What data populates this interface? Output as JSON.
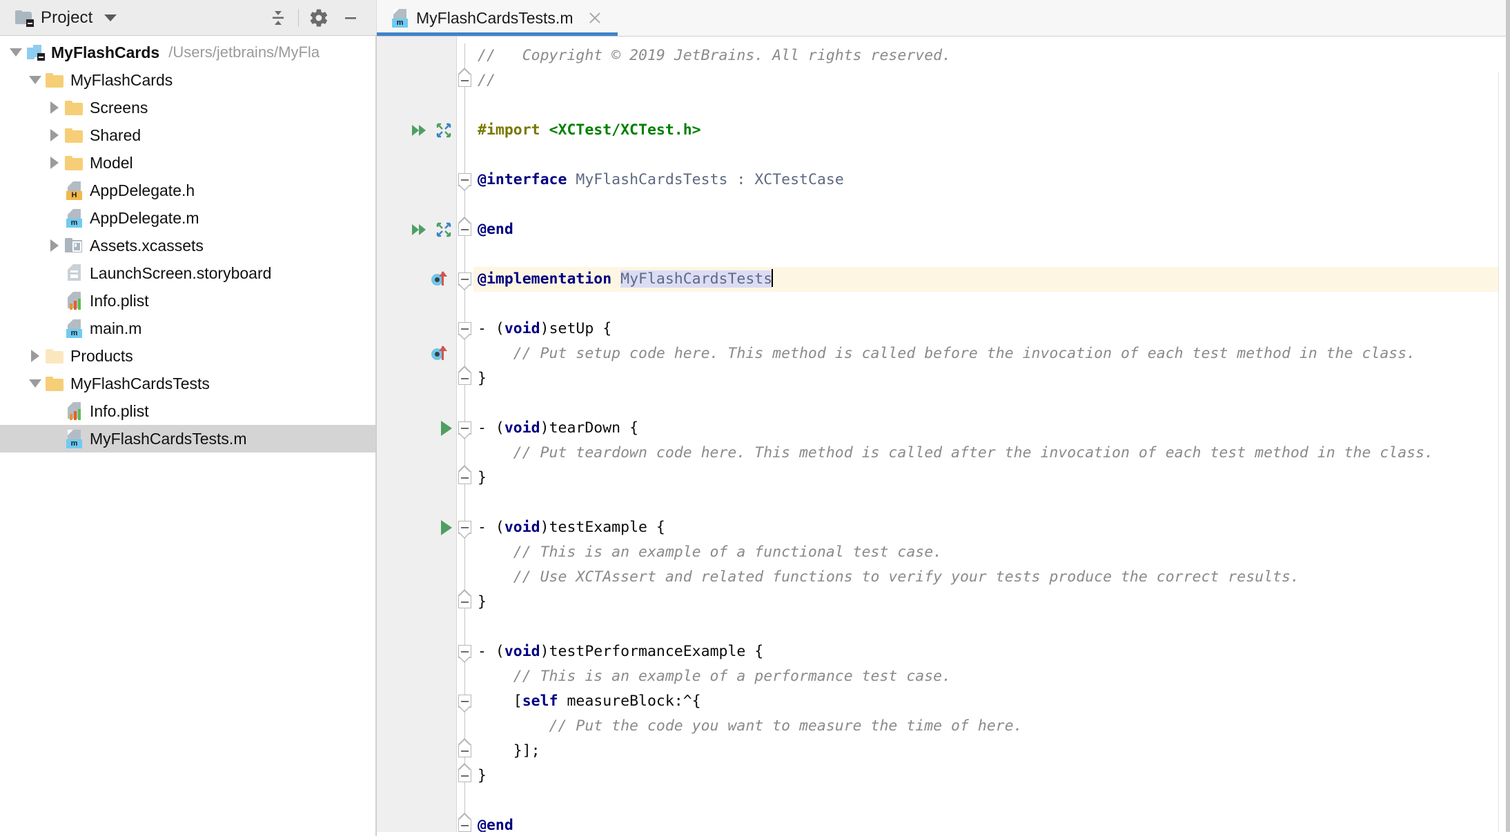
{
  "window": {
    "accent_color": "#4083c9",
    "toolwindow_bg": "#ececec",
    "gutter_bg": "#efefef",
    "selection_bg": "#d4d4d4",
    "caret_row_bg": "#fdf6e3",
    "identifier_highlight_bg": "#dcdcf5"
  },
  "project_toolbar": {
    "title": "Project",
    "title_icon": "project-folder-icon",
    "dropdown_icon": "chevron-down-icon",
    "collapse_all_icon": "collapse-all-icon",
    "settings_icon": "gear-icon",
    "hide_icon": "minimize-icon"
  },
  "tree": {
    "items": [
      {
        "label": "MyFlashCards",
        "path": "/Users/jetbrains/MyFla",
        "icon": "module-icon",
        "indent": 0,
        "twisty": "down",
        "bold": true,
        "selected": false
      },
      {
        "label": "MyFlashCards",
        "path": "",
        "icon": "folder-icon",
        "indent": 1,
        "twisty": "down",
        "bold": false,
        "selected": false
      },
      {
        "label": "Screens",
        "path": "",
        "icon": "folder-icon",
        "indent": 2,
        "twisty": "right",
        "bold": false,
        "selected": false
      },
      {
        "label": "Shared",
        "path": "",
        "icon": "folder-icon",
        "indent": 2,
        "twisty": "right",
        "bold": false,
        "selected": false
      },
      {
        "label": "Model",
        "path": "",
        "icon": "folder-icon",
        "indent": 2,
        "twisty": "right",
        "bold": false,
        "selected": false
      },
      {
        "label": "AppDelegate.h",
        "path": "",
        "icon": "objc-header-file-icon",
        "indent": 2,
        "twisty": "none",
        "bold": false,
        "selected": false
      },
      {
        "label": "AppDelegate.m",
        "path": "",
        "icon": "objc-source-file-icon",
        "indent": 2,
        "twisty": "none",
        "bold": false,
        "selected": false
      },
      {
        "label": "Assets.xcassets",
        "path": "",
        "icon": "xcassets-icon",
        "indent": 2,
        "twisty": "right",
        "bold": false,
        "selected": false
      },
      {
        "label": "LaunchScreen.storyboard",
        "path": "",
        "icon": "storyboard-file-icon",
        "indent": 2,
        "twisty": "none",
        "bold": false,
        "selected": false
      },
      {
        "label": "Info.plist",
        "path": "",
        "icon": "plist-file-icon",
        "indent": 2,
        "twisty": "none",
        "bold": false,
        "selected": false
      },
      {
        "label": "main.m",
        "path": "",
        "icon": "objc-source-file-icon",
        "indent": 2,
        "twisty": "none",
        "bold": false,
        "selected": false
      },
      {
        "label": "Products",
        "path": "",
        "icon": "folder-pale-icon",
        "indent": 1,
        "twisty": "right",
        "bold": false,
        "selected": false
      },
      {
        "label": "MyFlashCardsTests",
        "path": "",
        "icon": "folder-icon",
        "indent": 1,
        "twisty": "down",
        "bold": false,
        "selected": false
      },
      {
        "label": "Info.plist",
        "path": "",
        "icon": "plist-file-icon",
        "indent": 2,
        "twisty": "none",
        "bold": false,
        "selected": false
      },
      {
        "label": "MyFlashCardsTests.m",
        "path": "",
        "icon": "objc-source-file-icon",
        "indent": 2,
        "twisty": "none",
        "bold": false,
        "selected": true
      }
    ]
  },
  "editor": {
    "tabs": [
      {
        "label": "MyFlashCardsTests.m",
        "icon": "objc-source-file-icon",
        "active": true,
        "close_icon": "close-icon"
      }
    ],
    "gutter_markers": [
      {
        "line": 4,
        "icons": [
          "run-all-tests-icon",
          "related-symbol-icon"
        ]
      },
      {
        "line": 8,
        "icons": [
          "run-all-tests-icon",
          "related-symbol-icon"
        ]
      },
      {
        "line": 10,
        "icons": [
          "overriding-method-icon"
        ]
      },
      {
        "line": 13,
        "icons": [
          "overriding-method-icon"
        ]
      },
      {
        "line": 16,
        "icons": [
          "run-test-icon"
        ]
      },
      {
        "line": 20,
        "icons": [
          "run-test-icon"
        ]
      }
    ],
    "code_lines": [
      {
        "n": 1,
        "tokens": [
          {
            "t": "//   Copyright © 2019 JetBrains. All rights reserved.",
            "c": "cmt"
          }
        ]
      },
      {
        "n": 2,
        "tokens": [
          {
            "t": "//",
            "c": "cmt"
          }
        ]
      },
      {
        "n": 3,
        "tokens": []
      },
      {
        "n": 4,
        "tokens": [
          {
            "t": "#import ",
            "c": "pre"
          },
          {
            "t": "<XCTest/XCTest.h>",
            "c": "str"
          }
        ]
      },
      {
        "n": 5,
        "tokens": []
      },
      {
        "n": 6,
        "tokens": [
          {
            "t": "@interface",
            "c": "kw"
          },
          {
            "t": " ",
            "c": ""
          },
          {
            "t": "MyFlashCardsTests",
            "c": "cls"
          },
          {
            "t": " ",
            "c": ""
          },
          {
            "t": ":",
            "c": "cls"
          },
          {
            "t": " ",
            "c": ""
          },
          {
            "t": "XCTestCase",
            "c": "cls"
          }
        ]
      },
      {
        "n": 7,
        "tokens": []
      },
      {
        "n": 8,
        "tokens": [
          {
            "t": "@end",
            "c": "kw"
          }
        ]
      },
      {
        "n": 9,
        "tokens": []
      },
      {
        "n": 10,
        "tokens": [
          {
            "t": "@implementation",
            "c": "kw"
          },
          {
            "t": " ",
            "c": ""
          },
          {
            "t": "MyFlashCardsTests",
            "c": "cls sel"
          },
          {
            "t": "|caret|",
            "c": "caret"
          }
        ],
        "caret_row": true
      },
      {
        "n": 11,
        "tokens": []
      },
      {
        "n": 12,
        "tokens": [
          {
            "t": "- (",
            "c": ""
          },
          {
            "t": "void",
            "c": "kw"
          },
          {
            "t": ")setUp {",
            "c": ""
          }
        ]
      },
      {
        "n": 13,
        "tokens": [
          {
            "t": "    // Put setup code here. This method is called before the invocation of each test method in the class.",
            "c": "cmt"
          }
        ]
      },
      {
        "n": 14,
        "tokens": [
          {
            "t": "}",
            "c": ""
          }
        ]
      },
      {
        "n": 15,
        "tokens": []
      },
      {
        "n": 16,
        "tokens": [
          {
            "t": "- (",
            "c": ""
          },
          {
            "t": "void",
            "c": "kw"
          },
          {
            "t": ")tearDown {",
            "c": ""
          }
        ]
      },
      {
        "n": 17,
        "tokens": [
          {
            "t": "    // Put teardown code here. This method is called after the invocation of each test method in the class.",
            "c": "cmt"
          }
        ]
      },
      {
        "n": 18,
        "tokens": [
          {
            "t": "}",
            "c": ""
          }
        ]
      },
      {
        "n": 19,
        "tokens": []
      },
      {
        "n": 20,
        "tokens": [
          {
            "t": "- (",
            "c": ""
          },
          {
            "t": "void",
            "c": "kw"
          },
          {
            "t": ")testExample {",
            "c": ""
          }
        ]
      },
      {
        "n": 21,
        "tokens": [
          {
            "t": "    // This is an example of a functional test case.",
            "c": "cmt"
          }
        ]
      },
      {
        "n": 22,
        "tokens": [
          {
            "t": "    // Use XCTAssert and related functions to verify your tests produce the correct results.",
            "c": "cmt"
          }
        ]
      },
      {
        "n": 23,
        "tokens": [
          {
            "t": "}",
            "c": ""
          }
        ]
      },
      {
        "n": 24,
        "tokens": []
      },
      {
        "n": 25,
        "tokens": [
          {
            "t": "- (",
            "c": ""
          },
          {
            "t": "void",
            "c": "kw"
          },
          {
            "t": ")testPerformanceExample {",
            "c": ""
          }
        ]
      },
      {
        "n": 26,
        "tokens": [
          {
            "t": "    // This is an example of a performance test case.",
            "c": "cmt"
          }
        ]
      },
      {
        "n": 27,
        "tokens": [
          {
            "t": "    [",
            "c": ""
          },
          {
            "t": "self",
            "c": "kw"
          },
          {
            "t": " measureBlock:^{",
            "c": ""
          }
        ]
      },
      {
        "n": 28,
        "tokens": [
          {
            "t": "        // Put the code you want to measure the time of here.",
            "c": "cmt"
          }
        ]
      },
      {
        "n": 29,
        "tokens": [
          {
            "t": "    }];",
            "c": ""
          }
        ]
      },
      {
        "n": 30,
        "tokens": [
          {
            "t": "}",
            "c": ""
          }
        ]
      },
      {
        "n": 31,
        "tokens": []
      },
      {
        "n": 32,
        "tokens": [
          {
            "t": "@end",
            "c": "kw"
          }
        ]
      }
    ],
    "fold_markers": [
      {
        "line": 2,
        "type": "close"
      },
      {
        "line": 6,
        "type": "open"
      },
      {
        "line": 8,
        "type": "close"
      },
      {
        "line": 10,
        "type": "open"
      },
      {
        "line": 12,
        "type": "open"
      },
      {
        "line": 14,
        "type": "close"
      },
      {
        "line": 16,
        "type": "open"
      },
      {
        "line": 18,
        "type": "close"
      },
      {
        "line": 20,
        "type": "open"
      },
      {
        "line": 23,
        "type": "close"
      },
      {
        "line": 25,
        "type": "open"
      },
      {
        "line": 27,
        "type": "open"
      },
      {
        "line": 29,
        "type": "close"
      },
      {
        "line": 30,
        "type": "close"
      },
      {
        "line": 32,
        "type": "close"
      }
    ]
  }
}
